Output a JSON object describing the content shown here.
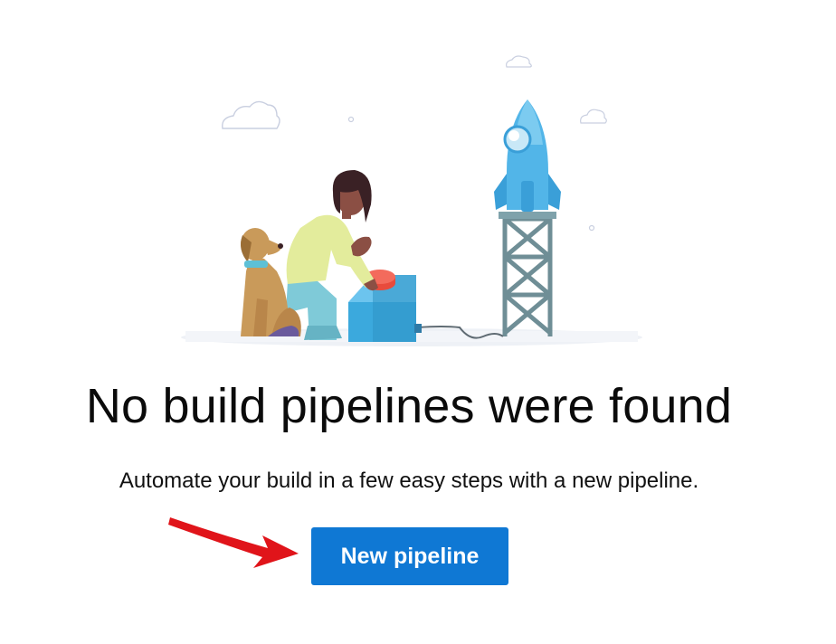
{
  "empty_state": {
    "title": "No build pipelines were found",
    "subtitle": "Automate your build in a few easy steps with a new pipeline.",
    "primary_button_label": "New pipeline"
  },
  "colors": {
    "button_bg": "#0f78d4",
    "button_text": "#ffffff",
    "arrow": "#e0141a",
    "rocket": "#52b5e8",
    "box": "#3ba9dd"
  },
  "icons": {
    "illustration": "rocket-launch-illustration",
    "annotation": "red-arrow-icon"
  }
}
